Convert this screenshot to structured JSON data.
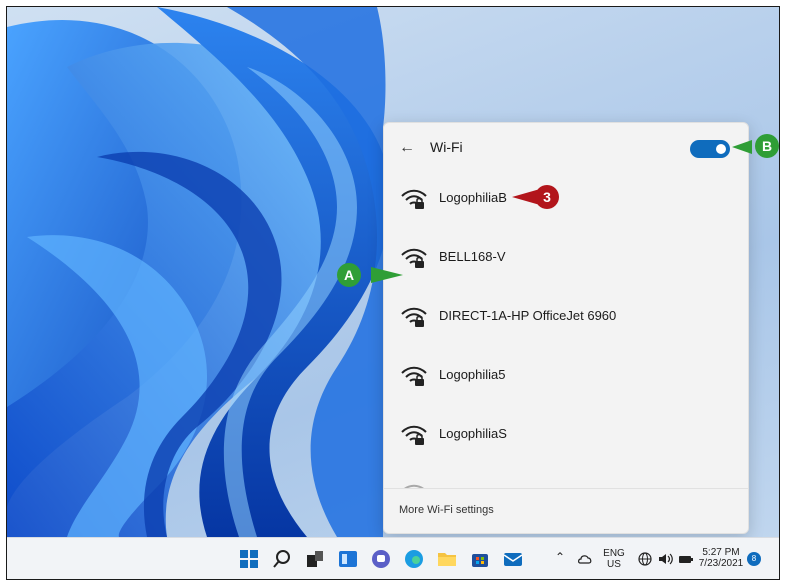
{
  "wifi_panel": {
    "title": "Wi-Fi",
    "toggle_on": true,
    "networks": [
      {
        "name": "LogophiliaB",
        "secured": true
      },
      {
        "name": "BELL168-V",
        "secured": true
      },
      {
        "name": "DIRECT-1A-HP OfficeJet 6960",
        "secured": true
      },
      {
        "name": "Logophilia5",
        "secured": true
      },
      {
        "name": "LogophiliaS",
        "secured": true
      }
    ],
    "more_settings_label": "More Wi-Fi settings"
  },
  "callouts": {
    "b": "B",
    "three": "3",
    "a": "A"
  },
  "taskbar": {
    "icons": [
      "start-icon",
      "search-icon",
      "task-view-icon",
      "widgets-icon",
      "chat-icon",
      "edge-icon",
      "file-explorer-icon",
      "store-icon",
      "mail-icon"
    ],
    "tray": {
      "language_top": "ENG",
      "language_bottom": "US",
      "time": "5:27 PM",
      "date": "7/23/2021",
      "notification_count": "8"
    }
  },
  "colors": {
    "accent": "#0f6cbd",
    "callout_green": "#2f9e36",
    "callout_red": "#b2151b"
  }
}
